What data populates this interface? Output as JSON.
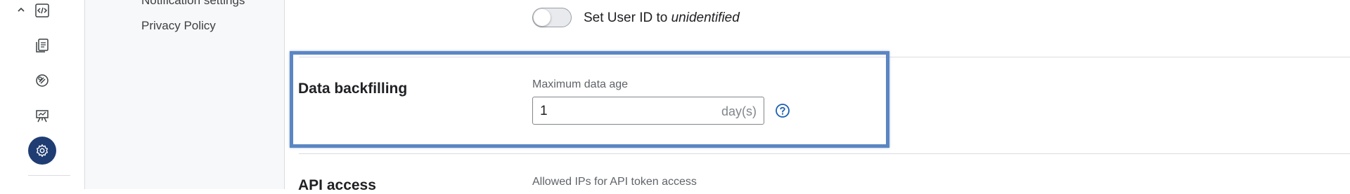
{
  "rail": {
    "icons": [
      "chevron-up-icon",
      "code-icon",
      "documents-icon",
      "integrations-icon",
      "dashboard-icon",
      "settings-icon"
    ]
  },
  "subnav": {
    "items": [
      "Notification settings",
      "Privacy Policy"
    ]
  },
  "user_id_toggle": {
    "label_prefix": "Set User ID to ",
    "label_emphasis": "unidentified",
    "state": "off"
  },
  "data_backfilling": {
    "title": "Data backfilling",
    "field_label": "Maximum data age",
    "value": "1",
    "unit": "day(s)",
    "help_icon": "question-circle-icon"
  },
  "api_access": {
    "title": "API access",
    "field_label": "Allowed IPs for API token access"
  },
  "colors": {
    "accent": "#1f3d73",
    "highlight": "#5b86c2",
    "help_icon": "#1a5fb4"
  }
}
